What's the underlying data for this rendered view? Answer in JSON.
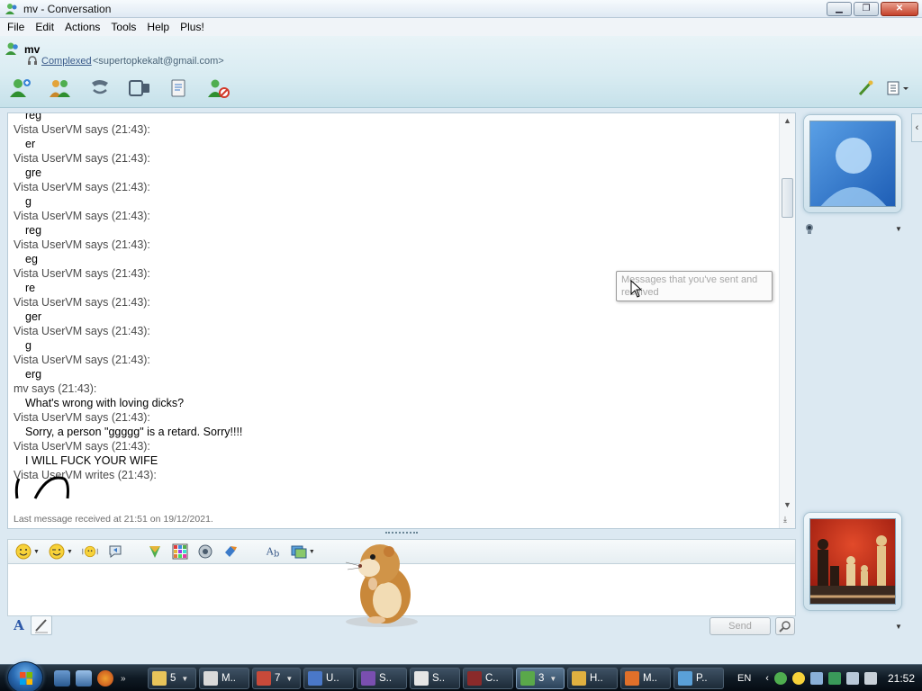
{
  "window": {
    "title": "mv - Conversation",
    "menu": [
      "File",
      "Edit",
      "Actions",
      "Tools",
      "Help",
      "Plus!"
    ]
  },
  "contact": {
    "name": "mv",
    "status": "Complexed",
    "email": "<supertopkekalt@gmail.com>"
  },
  "history": {
    "partial_top": "reg",
    "messages": [
      {
        "header": "Vista UserVM says (21:43):",
        "text": "er"
      },
      {
        "header": "Vista UserVM says (21:43):",
        "text": "gre"
      },
      {
        "header": "Vista UserVM says (21:43):",
        "text": "g"
      },
      {
        "header": "Vista UserVM says (21:43):",
        "text": "reg"
      },
      {
        "header": "Vista UserVM says (21:43):",
        "text": "eg"
      },
      {
        "header": "Vista UserVM says (21:43):",
        "text": "re"
      },
      {
        "header": "Vista UserVM says (21:43):",
        "text": "ger"
      },
      {
        "header": "Vista UserVM says (21:43):",
        "text": "g"
      },
      {
        "header": "Vista UserVM says (21:43):",
        "text": "erg"
      },
      {
        "header": "mv says (21:43):",
        "text": "What's wrong with loving dicks?"
      },
      {
        "header": "Vista UserVM says (21:43):",
        "text": "Sorry, a person \"ggggg\" is a retard. Sorry!!!!"
      },
      {
        "header": "Vista UserVM says (21:43):",
        "text": "I WILL FUCK YOUR WIFE"
      },
      {
        "header": "Vista UserVM writes (21:43):",
        "text": ""
      }
    ],
    "last_received": "Last message received at 21:51 on 19/12/2021."
  },
  "tooltip": "Messages that you've sent and received",
  "compose": {
    "font_label": "A",
    "send_label": "Send"
  },
  "taskbar": {
    "tasks": [
      {
        "label": "5",
        "icon": "folder-icon",
        "color": "#e8c45a",
        "group": true
      },
      {
        "label": "M..",
        "icon": "media-icon",
        "color": "#d9d9d9",
        "group": false
      },
      {
        "label": "7",
        "icon": "apps-icon",
        "color": "#c84a3a",
        "group": true
      },
      {
        "label": "U..",
        "icon": "editor-icon",
        "color": "#4a78c8",
        "group": false
      },
      {
        "label": "S..",
        "icon": "visual-studio-icon",
        "color": "#7a4fb0",
        "group": false
      },
      {
        "label": "S..",
        "icon": "card-icon",
        "color": "#e6e6e6",
        "group": false
      },
      {
        "label": "C..",
        "icon": "terminal-icon",
        "color": "#8a2a2a",
        "group": false
      },
      {
        "label": "3",
        "icon": "messenger-icon",
        "color": "#5aa84a",
        "group": true,
        "active": true
      },
      {
        "label": "H..",
        "icon": "chrome-icon",
        "color": "#e0b040",
        "group": false
      },
      {
        "label": "M..",
        "icon": "firefox-icon",
        "color": "#e0702a",
        "group": false
      },
      {
        "label": "P..",
        "icon": "paint-icon",
        "color": "#5aa0d8",
        "group": false
      }
    ],
    "tray": {
      "lang": "EN",
      "time": "21:52"
    }
  }
}
